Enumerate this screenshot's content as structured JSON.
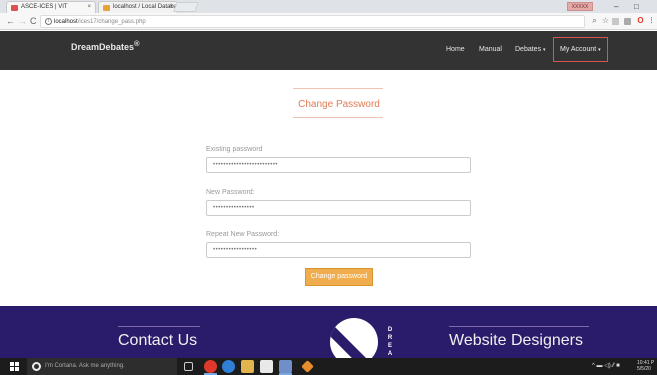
{
  "browser": {
    "tabs": [
      {
        "title": "ASCE-ICES | VIT",
        "active": true
      },
      {
        "title": "localhost / Local Databa",
        "active": false
      }
    ],
    "tab_close": "×",
    "profile_label": "XXXXX",
    "window_controls": {
      "minimize": "–",
      "maximize": "□"
    },
    "address": {
      "host": "localhost",
      "path": "/ices17/change_pass.php"
    },
    "nav": {
      "back": "←",
      "forward": "→",
      "reload": "C"
    },
    "toolbar_icons": [
      "zoom-icon",
      "key-icon",
      "star-icon",
      "extension-icon",
      "extension-icon",
      "pocket-icon",
      "opera-icon",
      "shield-icon",
      "menu-icon"
    ]
  },
  "site": {
    "brand": "DreamDebates",
    "brand_mark": "®",
    "nav": {
      "home": "Home",
      "manual": "Manual",
      "debates": "Debates",
      "account": "My Account"
    }
  },
  "form": {
    "title": "Change Password",
    "fields": [
      {
        "label": "Existing password",
        "value": "•••••••••••••••••••••••••"
      },
      {
        "label": "New Password:",
        "value": "••••••••••••••••"
      },
      {
        "label": "Repeat New Password:",
        "value": "•••••••••••••••••"
      }
    ],
    "submit": "Change password"
  },
  "footer": {
    "contact_heading": "Contact Us",
    "designers_heading": "Website Designers",
    "logo_letters": "D R E A"
  },
  "taskbar": {
    "search_placeholder": "I'm Cortana. Ask me anything.",
    "clock_time": "10:41 P",
    "clock_date": "5/5/20",
    "tray": "^ ▬ ◁) ⁄⁄ ■"
  },
  "colors": {
    "navbar_bg": "#333333",
    "accent": "#e07b54",
    "button_bg": "#f0ad4e",
    "footer_bg": "#2b1b6b",
    "account_border": "#d9534f"
  }
}
